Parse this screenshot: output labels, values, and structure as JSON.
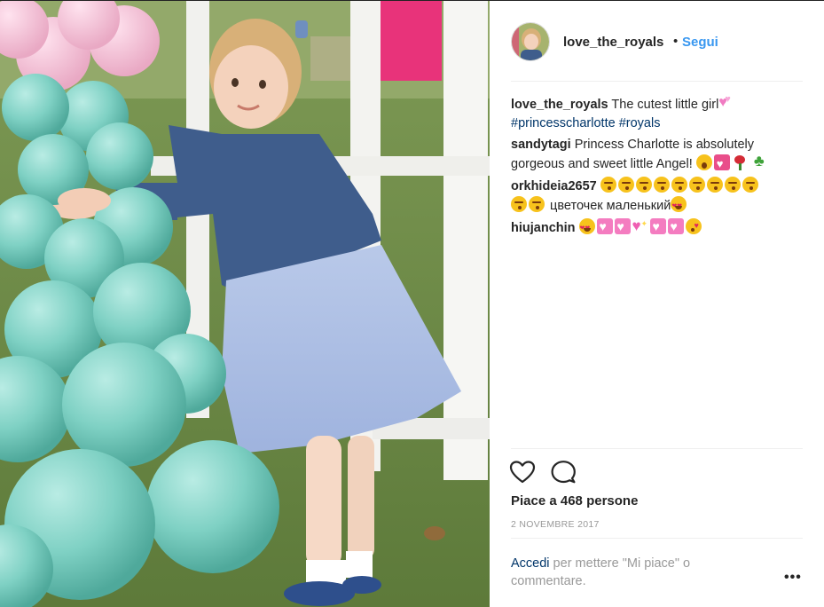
{
  "post": {
    "username": "love_the_royals",
    "separator_dot": "•",
    "follow_label": "Segui",
    "likes_text": "Piace a 468 persone",
    "date_text": "2 NOVEMBRE 2017",
    "login_link": "Accedi",
    "login_rest": " per mettere \"Mi piace\" o commentare.",
    "more_label": "•••"
  },
  "comments": [
    {
      "user": "love_the_royals",
      "text": "The cutest little girl",
      "emojis_after_text": [
        "pink-hearts"
      ],
      "hashtags": [
        "#princesscharlotte",
        "#royals"
      ]
    },
    {
      "user": "sandytagi",
      "text": "Princess Charlotte is absolutely gorgeous and sweet little Angel!",
      "emojis_after_text": [
        "astonished-face",
        "heart-gift",
        "rose",
        "four-leaf-clover"
      ]
    },
    {
      "user": "orkhideia2657",
      "emojis_before_text": [
        "kissing-face",
        "kissing-face",
        "kissing-face",
        "kissing-face",
        "kissing-face",
        "kissing-face",
        "kissing-face",
        "kissing-face",
        "kissing-face",
        "kissing-face",
        "kissing-face"
      ],
      "text": "цветочек маленький",
      "emojis_after_text": [
        "heart-eyes-face"
      ]
    },
    {
      "user": "hiujanchin",
      "text": "",
      "emojis_after_text": [
        "heart-eyes-face",
        "heart-ribbon",
        "heart-ribbon",
        "sparkling-heart",
        "heart-ribbon",
        "heart-ribbon",
        "face-blowing-kiss"
      ]
    }
  ],
  "icons": {
    "like": "heart-outline-icon",
    "comment": "speech-bubble-icon",
    "more": "more-options-icon"
  },
  "colors": {
    "link_blue": "#3897f0",
    "hashtag_navy": "#003569",
    "muted_gray": "#999999",
    "text_dark": "#262626"
  }
}
